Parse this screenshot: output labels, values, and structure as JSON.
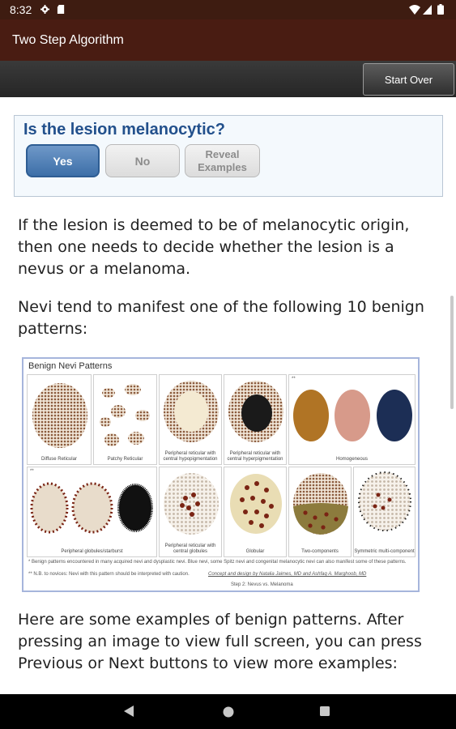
{
  "status_bar": {
    "time": "8:32",
    "icons": [
      "settings-gear-icon",
      "sd-card-icon",
      "wifi-icon",
      "cellular-signal-icon",
      "battery-icon"
    ]
  },
  "app_bar": {
    "title": "Two Step Algorithm"
  },
  "toolbar": {
    "start_over_label": "Start Over"
  },
  "question": {
    "text": "Is the lesion melanocytic?",
    "buttons": [
      {
        "label": "Yes",
        "state": "selected"
      },
      {
        "label": "No",
        "state": "default"
      },
      {
        "label": "Reveal Examples",
        "state": "default"
      }
    ]
  },
  "body": {
    "para1": "If the lesion is deemed to be of melanocytic origin, then one needs to decide whether the lesion is a nevus or a melanoma.",
    "para2": "Nevi tend to manifest one of the following 10 benign patterns:",
    "para3": "Here are some examples of benign patterns. After pressing an image to view full screen, you can press Previous or Next buttons to view more examples:"
  },
  "figure": {
    "title": "Benign Nevi Patterns",
    "row1": [
      {
        "caption": "Diffuse Reticular"
      },
      {
        "caption": "Patchy Reticular"
      },
      {
        "caption": "Peripheral reticular with central hypopigmentation"
      },
      {
        "caption": "Peripheral reticular with central hyperpigmentation"
      },
      {
        "caption": "Homogeneous",
        "marker": "**"
      }
    ],
    "row2": [
      {
        "caption": "Peripheral globules/starburst",
        "marker": "**"
      },
      {
        "caption": "Peripheral reticular with central globules"
      },
      {
        "caption": "Globular"
      },
      {
        "caption": "Two-components"
      },
      {
        "caption": "Symmetric multi-component"
      }
    ],
    "footnote1": "* Benign patterns encountered in many acquired nevi and dysplastic nevi. Blue nevi, some Spitz nevi and congenital melanocytic nevi can also manifest some of these patterns.",
    "footnote2": "** N.B. to novices: Nevi with this pattern should be interpreted with caution.",
    "credit": "Concept and design by Natalia Jaimes, MD and Ashfaq A. Marghoob, MD",
    "step_label": "Step 2: Nevus vs. Melanoma",
    "colors": {
      "reticular": "#a27a5c",
      "dark": "#1a1a1a",
      "homog_brown": "#b07425",
      "homog_pink": "#d79a8a",
      "homog_blue": "#1c2e55",
      "globule": "#7a2414"
    }
  },
  "nav_bar": {
    "icons": [
      "back-triangle-icon",
      "home-circle-icon",
      "recents-square-icon"
    ]
  }
}
